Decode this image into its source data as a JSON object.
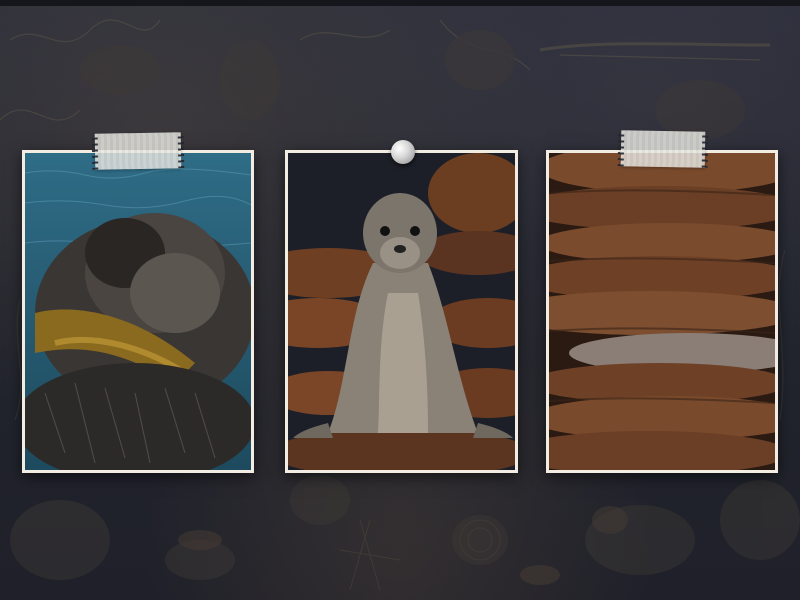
{
  "scene": {
    "background_color": "#23262f",
    "frame_color": "#f3ece2"
  },
  "photos": [
    {
      "subject": "sea-otter",
      "attachment": "tape",
      "alt": ""
    },
    {
      "subject": "sea-lion-pup",
      "attachment": "pin",
      "alt": ""
    },
    {
      "subject": "sea-lion-colony",
      "attachment": "tape",
      "alt": ""
    }
  ],
  "icons": {
    "tape": "masking-tape",
    "pin": "push-pin"
  }
}
